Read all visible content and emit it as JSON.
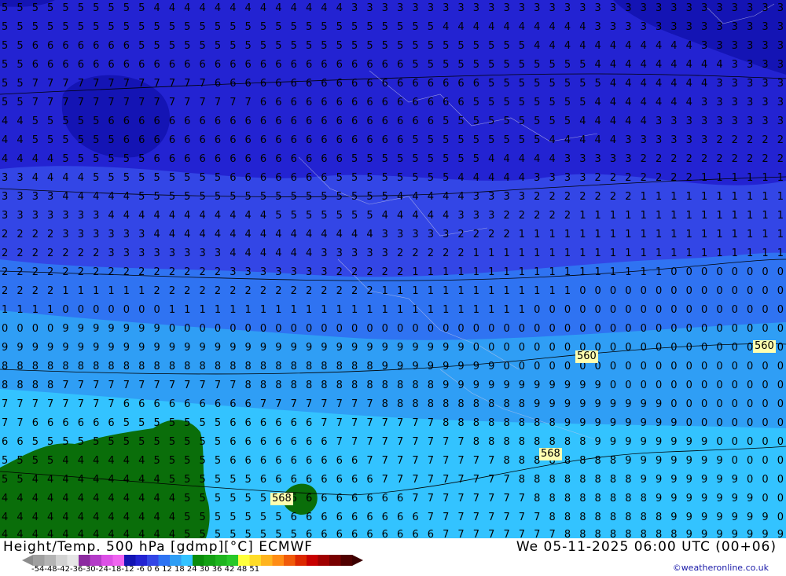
{
  "map": {
    "contour_labels": [
      "560",
      "560",
      "568",
      "568"
    ],
    "colors": {
      "deep": "#1414b4",
      "dark": "#2323d2",
      "mid": "#3346e6",
      "light": "#2f73f2",
      "cyan": "#2f9ef5",
      "aqua": "#33c3ff",
      "land": "#0a6e0a",
      "number_color": "#000000"
    }
  },
  "footer": {
    "title": "Height/Temp. 500 hPa [gdmp][°C] ECMWF",
    "datetime": "We 05-11-2025 06:00 UTC (00+06)",
    "credit": "©weatheronline.co.uk"
  },
  "legend": {
    "ticks": "-54-48-42-36-30-24-18-12 -6  0  6  12  18  24  30  36  42  48  51",
    "swatches": [
      "#a0a0a0",
      "#b4b4b4",
      "#d2d2d2",
      "#e6e6e6",
      "#8c2ca0",
      "#b43cc8",
      "#dc50e6",
      "#f064f0",
      "#1414b4",
      "#2323d2",
      "#3346e6",
      "#2f73f2",
      "#2f9ef5",
      "#33c3ff",
      "#0a8c0a",
      "#14a014",
      "#1eb41e",
      "#28c828",
      "#ffff3c",
      "#ffdc28",
      "#ffb41e",
      "#ff8c14",
      "#f05a0a",
      "#dc2800",
      "#c80000",
      "#a00000",
      "#780000",
      "#500000"
    ]
  }
}
